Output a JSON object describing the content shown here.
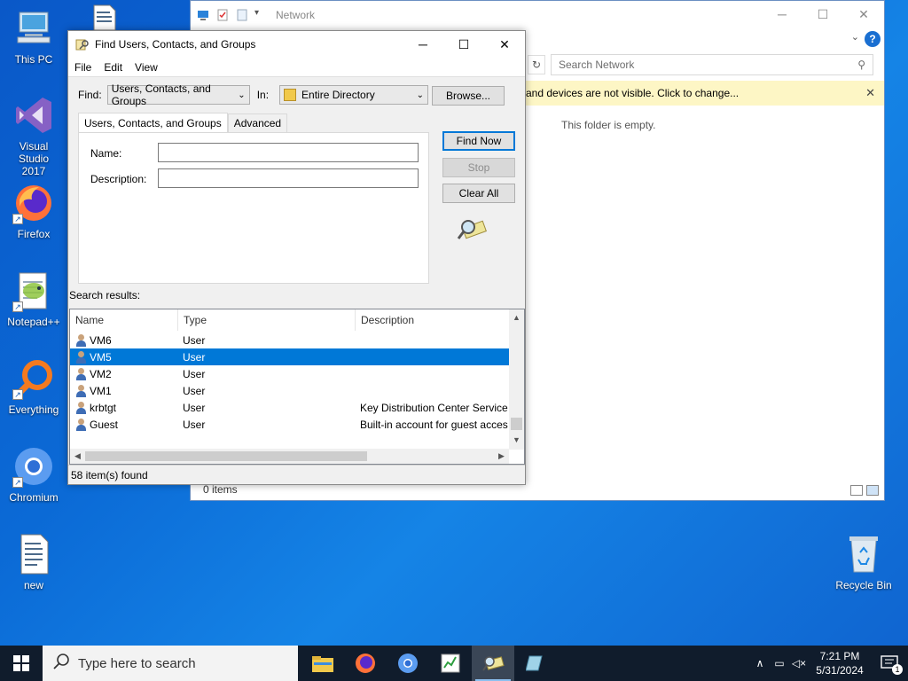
{
  "desktop": {
    "icons": [
      {
        "label": "This PC"
      },
      {
        "label": "Visual Studio 2017"
      },
      {
        "label": "Firefox"
      },
      {
        "label": "Notepad++"
      },
      {
        "label": "Everything"
      },
      {
        "label": "Chromium"
      },
      {
        "label": "new"
      },
      {
        "label": "Recycle Bin"
      }
    ]
  },
  "explorer": {
    "title": "Network",
    "search_placeholder": "Search Network",
    "info_bar": "and devices are not visible. Click to change...",
    "empty_text": "This folder is empty.",
    "status": "0 items"
  },
  "dialog": {
    "title": "Find Users, Contacts, and Groups",
    "menu": [
      "File",
      "Edit",
      "View"
    ],
    "find_label": "Find:",
    "find_value": "Users, Contacts, and Groups",
    "in_label": "In:",
    "in_value": "Entire Directory",
    "browse_label": "Browse...",
    "tabs": [
      "Users, Contacts, and Groups",
      "Advanced"
    ],
    "name_label": "Name:",
    "description_label": "Description:",
    "find_now_label": "Find Now",
    "stop_label": "Stop",
    "clear_all_label": "Clear All",
    "results_label": "Search results:",
    "columns": [
      "Name",
      "Type",
      "Description"
    ],
    "rows": [
      {
        "name": "VM6",
        "type": "User",
        "description": ""
      },
      {
        "name": "VM5",
        "type": "User",
        "description": "",
        "selected": true
      },
      {
        "name": "VM2",
        "type": "User",
        "description": ""
      },
      {
        "name": "VM1",
        "type": "User",
        "description": ""
      },
      {
        "name": "krbtgt",
        "type": "User",
        "description": "Key Distribution Center Service A"
      },
      {
        "name": "Guest",
        "type": "User",
        "description": "Built-in account for guest acces"
      }
    ],
    "status": "58 item(s) found"
  },
  "taskbar": {
    "search_placeholder": "Type here to search",
    "time": "7:21 PM",
    "date": "5/31/2024",
    "notification_count": "1"
  },
  "colors": {
    "accent": "#0078d7",
    "desktop": "#0b6ad6",
    "taskbar": "#101c2c",
    "info_bar": "#fdf6c5"
  }
}
